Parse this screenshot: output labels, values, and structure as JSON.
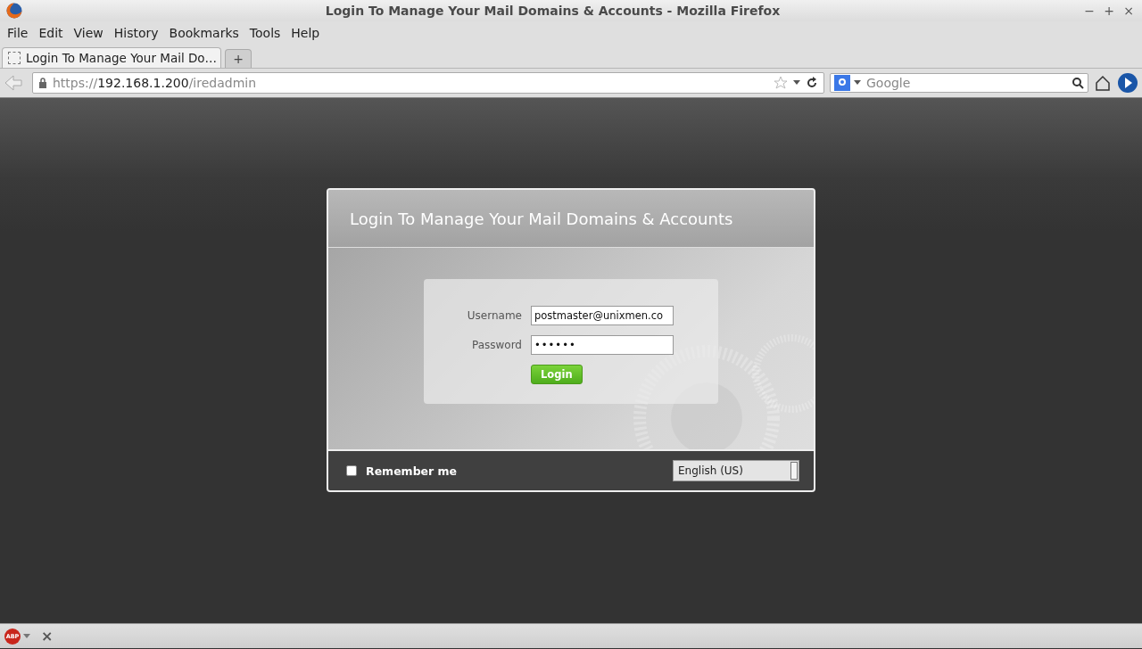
{
  "window": {
    "title": "Login To Manage Your Mail Domains & Accounts - Mozilla Firefox",
    "controls": [
      "−",
      "+",
      "×"
    ]
  },
  "menu": [
    "File",
    "Edit",
    "View",
    "History",
    "Bookmarks",
    "Tools",
    "Help"
  ],
  "tabs": [
    {
      "label": "Login To Manage Your Mail Do…",
      "selected": true
    }
  ],
  "new_tab": "+",
  "address": {
    "scheme": "https://",
    "host": "192.168.1.200",
    "path": "/iredadmin"
  },
  "search": {
    "placeholder": "Google"
  },
  "dialog": {
    "title": "Login To Manage Your Mail Domains & Accounts",
    "fields": [
      {
        "label": "Username",
        "value": "postmaster@unixmen.co",
        "kind": "text"
      },
      {
        "label": "Password",
        "value": "••••••",
        "kind": "password"
      }
    ],
    "login_button": "Login",
    "remember": {
      "label": "Remember me",
      "checked": false
    },
    "language": "English (US)"
  },
  "addon_bar": {
    "badge": "ABP",
    "close": "×"
  }
}
